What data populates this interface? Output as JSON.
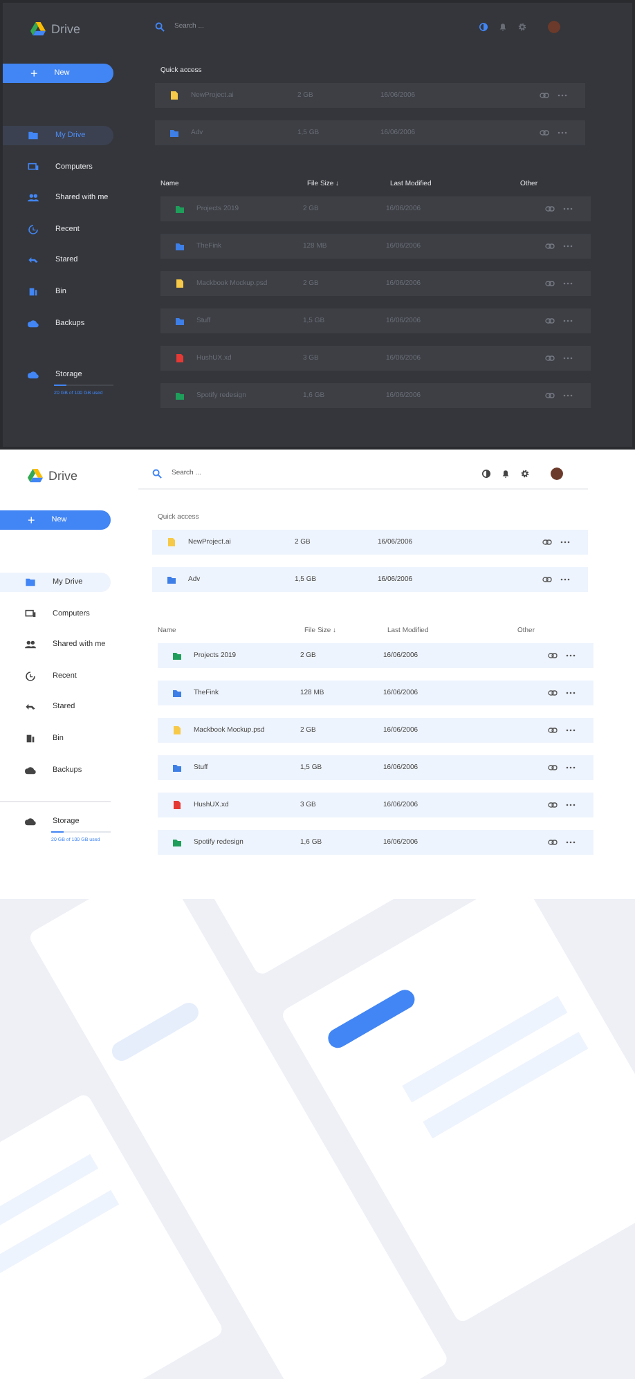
{
  "screens": [
    {
      "kind": "dark",
      "app_name": "Drive",
      "search": {
        "placeholder": "Search ..."
      },
      "new_button": {
        "label": "New",
        "icon": "+"
      },
      "sidebar": {
        "items": [
          {
            "label": "My Drive",
            "selected": true
          },
          {
            "label": "Computers",
            "selected": false
          },
          {
            "label": "Shared with me",
            "selected": false
          },
          {
            "label": "Recent",
            "selected": false
          },
          {
            "label": "Stared",
            "selected": false
          },
          {
            "label": "Bin",
            "selected": false
          },
          {
            "label": "Backups",
            "selected": false
          }
        ]
      },
      "storage": {
        "label": "Storage",
        "level": 0.2,
        "usage": "20 GB of 100 GB used"
      },
      "quick_access": {
        "title": "Quick access",
        "rows": [
          {
            "kind": "file",
            "color": "#f7c948",
            "name": "NewProject.ai",
            "size": "2 GB",
            "modified": "16/06/2006"
          },
          {
            "kind": "folder",
            "color": "#3d7fe6",
            "name": "Adv",
            "size": "1,5 GB",
            "modified": "16/06/2006"
          }
        ]
      },
      "table": {
        "columns": [
          "Name",
          "File Size ↓",
          "Last Modified",
          "Other"
        ],
        "rows": [
          {
            "kind": "folder",
            "color": "#1e9e5a",
            "name": "Projects 2019",
            "size": "2 GB",
            "modified": "16/06/2006"
          },
          {
            "kind": "folder",
            "color": "#3d7fe6",
            "name": "TheFink",
            "size": "128 MB",
            "modified": "16/06/2006"
          },
          {
            "kind": "file",
            "color": "#f7c948",
            "name": "Mackbook Mockup.psd",
            "size": "2 GB",
            "modified": "16/06/2006"
          },
          {
            "kind": "folder",
            "color": "#3d7fe6",
            "name": "Stuff",
            "size": "1,5 GB",
            "modified": "16/06/2006"
          },
          {
            "kind": "file",
            "color": "#e53935",
            "name": "HushUX.xd",
            "size": "3 GB",
            "modified": "16/06/2006"
          },
          {
            "kind": "folder",
            "color": "#1e9e5a",
            "name": "Spotify redesign",
            "size": "1,6 GB",
            "modified": "16/06/2006"
          }
        ]
      }
    },
    {
      "kind": "light",
      "app_name": "Drive",
      "search": {
        "placeholder": "Search ..."
      },
      "new_button": {
        "label": "New",
        "icon": "+"
      },
      "sidebar": {
        "items": [
          {
            "label": "My Drive",
            "selected": true
          },
          {
            "label": "Computers",
            "selected": false
          },
          {
            "label": "Shared with me",
            "selected": false
          },
          {
            "label": "Recent",
            "selected": false
          },
          {
            "label": "Stared",
            "selected": false
          },
          {
            "label": "Bin",
            "selected": false
          },
          {
            "label": "Backups",
            "selected": false
          }
        ]
      },
      "storage": {
        "label": "Storage",
        "level": 0.2,
        "usage": "20 GB of 100 GB used"
      },
      "quick_access": {
        "title": "Quick access",
        "rows": [
          {
            "kind": "file",
            "color": "#f7c948",
            "name": "NewProject.ai",
            "size": "2 GB",
            "modified": "16/06/2006"
          },
          {
            "kind": "folder",
            "color": "#3d7fe6",
            "name": "Adv",
            "size": "1,5 GB",
            "modified": "16/06/2006"
          }
        ]
      },
      "table": {
        "columns": [
          "Name",
          "File Size ↓",
          "Last Modified",
          "Other"
        ],
        "rows": [
          {
            "kind": "folder",
            "color": "#1e9e5a",
            "name": "Projects 2019",
            "size": "2 GB",
            "modified": "16/06/2006"
          },
          {
            "kind": "folder",
            "color": "#3d7fe6",
            "name": "TheFink",
            "size": "128 MB",
            "modified": "16/06/2006"
          },
          {
            "kind": "file",
            "color": "#f7c948",
            "name": "Mackbook Mockup.psd",
            "size": "2 GB",
            "modified": "16/06/2006"
          },
          {
            "kind": "folder",
            "color": "#3d7fe6",
            "name": "Stuff",
            "size": "1,5 GB",
            "modified": "16/06/2006"
          },
          {
            "kind": "file",
            "color": "#e53935",
            "name": "HushUX.xd",
            "size": "3 GB",
            "modified": "16/06/2006"
          },
          {
            "kind": "folder",
            "color": "#1e9e5a",
            "name": "Spotify redesign",
            "size": "1,6 GB",
            "modified": "16/06/2006"
          }
        ]
      }
    }
  ]
}
